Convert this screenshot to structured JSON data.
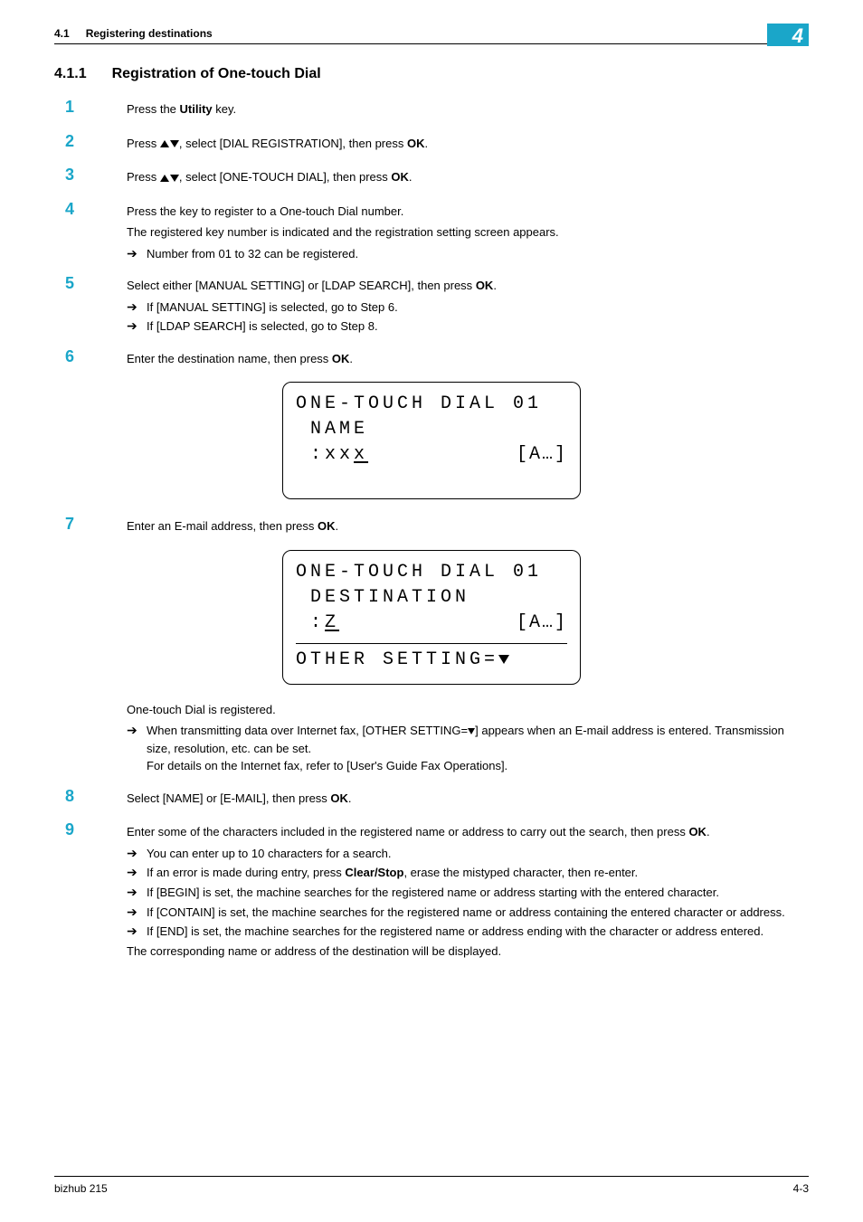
{
  "header": {
    "section_number": "4.1",
    "section_title": "Registering destinations",
    "chapter_tab": "4"
  },
  "heading": {
    "number": "4.1.1",
    "title": "Registration of One-touch Dial"
  },
  "steps": {
    "s1": {
      "marker": "1",
      "text_a": "Press the ",
      "bold": "Utility",
      "text_b": " key."
    },
    "s2": {
      "marker": "2",
      "text_a": "Press ",
      "text_b": ", select [DIAL REGISTRATION], then press ",
      "bold": "OK",
      "text_c": "."
    },
    "s3": {
      "marker": "3",
      "text_a": "Press ",
      "text_b": ", select [ONE-TOUCH DIAL], then press ",
      "bold": "OK",
      "text_c": "."
    },
    "s4": {
      "marker": "4",
      "lead": "Press the key to register to a One-touch Dial number.",
      "para": "The registered key number is indicated and the registration setting screen appears.",
      "sub1": "Number from 01 to 32 can be registered."
    },
    "s5": {
      "marker": "5",
      "text_a": "Select either [MANUAL SETTING] or [LDAP SEARCH], then press ",
      "bold": "OK",
      "text_b": ".",
      "sub1": "If [MANUAL SETTING] is selected, go to Step 6.",
      "sub2": "If [LDAP SEARCH] is selected, go to Step 8."
    },
    "s6": {
      "marker": "6",
      "text_a": "Enter the destination name, then press ",
      "bold": "OK",
      "text_b": "."
    },
    "s7": {
      "marker": "7",
      "text_a": "Enter an E-mail address, then press ",
      "bold": "OK",
      "text_b": ".",
      "after1": "One-touch Dial is registered.",
      "sub1_a": "When transmitting data over Internet fax, [OTHER SETTING=",
      "sub1_b": "] appears when an E-mail address is entered. Transmission size, resolution, etc. can be set.",
      "sub1_c": "For details on the Internet fax, refer to [User's Guide Fax Operations]."
    },
    "s8": {
      "marker": "8",
      "text_a": "Select [NAME] or [E-MAIL], then press ",
      "bold": "OK",
      "text_b": "."
    },
    "s9": {
      "marker": "9",
      "lead_a": "Enter some of the characters included in the registered name or address to carry out the search, then press ",
      "bold": "OK",
      "lead_b": ".",
      "sub1": "You can enter up to 10 characters for a search.",
      "sub2_a": "If an error is made during entry, press ",
      "sub2_bold": "Clear/Stop",
      "sub2_b": ", erase the mistyped character, then re-enter.",
      "sub3": "If [BEGIN] is set, the machine searches for the registered name or address starting with the entered character.",
      "sub4": "If [CONTAIN] is set, the machine searches for the registered name or address containing the entered character or address.",
      "sub5": "If [END] is set, the machine searches for the registered name or address ending with the character or address entered.",
      "after": "The corresponding name or address of the destination will be displayed."
    }
  },
  "lcd1": {
    "line1": "ONE-TOUCH DIAL 01",
    "line2": "NAME",
    "line3_left_prefix": ":xx",
    "line3_left_cursor": "x",
    "line3_right": "[A…]"
  },
  "lcd2": {
    "line1": "ONE-TOUCH DIAL 01",
    "line2": "DESTINATION",
    "line3_left_prefix": ":",
    "line3_left_cursor": "Z",
    "line3_right": "[A…]",
    "line4_prefix": "OTHER SETTING="
  },
  "footer": {
    "product": "bizhub 215",
    "page": "4-3"
  }
}
